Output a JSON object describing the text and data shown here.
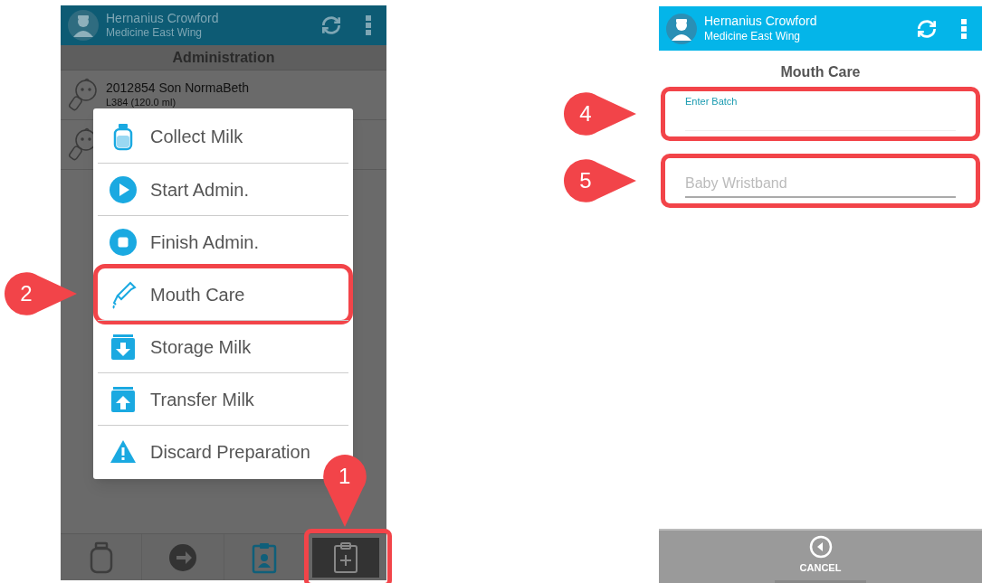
{
  "left_screen": {
    "header": {
      "name": "Hernanius Crowford",
      "ward": "Medicine East Wing"
    },
    "title": "Administration",
    "rows": [
      {
        "name": "2012854 Son NormaBeth",
        "detail": "L384 (120.0 ml)"
      },
      {}
    ],
    "menu": [
      {
        "label": "Collect Milk",
        "kind": "bottle",
        "highlighted": false
      },
      {
        "label": "Start Admin.",
        "kind": "play",
        "highlighted": false
      },
      {
        "label": "Finish Admin.",
        "kind": "stop",
        "highlighted": false
      },
      {
        "label": "Mouth Care",
        "kind": "dropper",
        "highlighted": true,
        "callout": "2"
      },
      {
        "label": "Storage Milk",
        "kind": "down",
        "highlighted": false
      },
      {
        "label": "Transfer Milk",
        "kind": "up",
        "highlighted": false
      },
      {
        "label": "Discard Preparation",
        "kind": "warning",
        "highlighted": false
      }
    ],
    "nav": [
      {
        "kind": "bottle",
        "selected": false
      },
      {
        "kind": "swap",
        "selected": false
      },
      {
        "kind": "badge",
        "selected": false
      },
      {
        "kind": "clipboard",
        "selected": true,
        "callout": "1"
      }
    ]
  },
  "right_screen": {
    "header": {
      "name": "Hernanius Crowford",
      "ward": "Medicine East Wing"
    },
    "title": "Mouth Care",
    "fields": [
      {
        "label": "Enter Batch",
        "callout": "4"
      },
      {
        "placeholder": "Baby Wristband",
        "callout": "5"
      }
    ],
    "cancel": "CANCEL"
  }
}
